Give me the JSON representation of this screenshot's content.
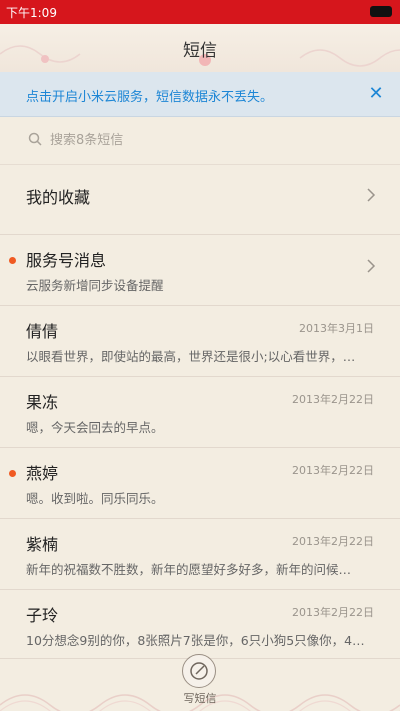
{
  "status_bar": {
    "time": "下午1:09"
  },
  "header": {
    "title": "短信"
  },
  "banner": {
    "text": "点击开启小米云服务，短信数据永不丢失。",
    "close_icon": "close-icon"
  },
  "search": {
    "placeholder": "搜索8条短信"
  },
  "list": [
    {
      "name": "我的收藏",
      "preview": "",
      "date": "",
      "unread": false,
      "chevron": true
    },
    {
      "name": "服务号消息",
      "preview": "云服务新增同步设备提醒",
      "date": "",
      "unread": true,
      "chevron": true
    },
    {
      "name": "倩倩",
      "preview": "以眼看世界，即使站的最高，世界还是很小;以心看世界，…",
      "date": "2013年3月1日",
      "unread": false,
      "chevron": false
    },
    {
      "name": "果冻",
      "preview": "嗯，今天会回去的早点。",
      "date": "2013年2月22日",
      "unread": false,
      "chevron": false
    },
    {
      "name": "燕婷",
      "preview": "嗯。收到啦。同乐同乐。",
      "date": "2013年2月22日",
      "unread": true,
      "chevron": false
    },
    {
      "name": "紫楠",
      "preview": "新年的祝福数不胜数，新年的愿望好多好多，新年的问候…",
      "date": "2013年2月22日",
      "unread": false,
      "chevron": false
    },
    {
      "name": "子玲",
      "preview": "10分想念9别的你，8张照片7张是你，6只小狗5只像你，4…",
      "date": "2013年2月22日",
      "unread": false,
      "chevron": false
    }
  ],
  "compose": {
    "label": "写短信"
  },
  "colors": {
    "status_red": "#d6161c",
    "accent_blue": "#1d86d5",
    "unread_orange": "#f05a22"
  }
}
